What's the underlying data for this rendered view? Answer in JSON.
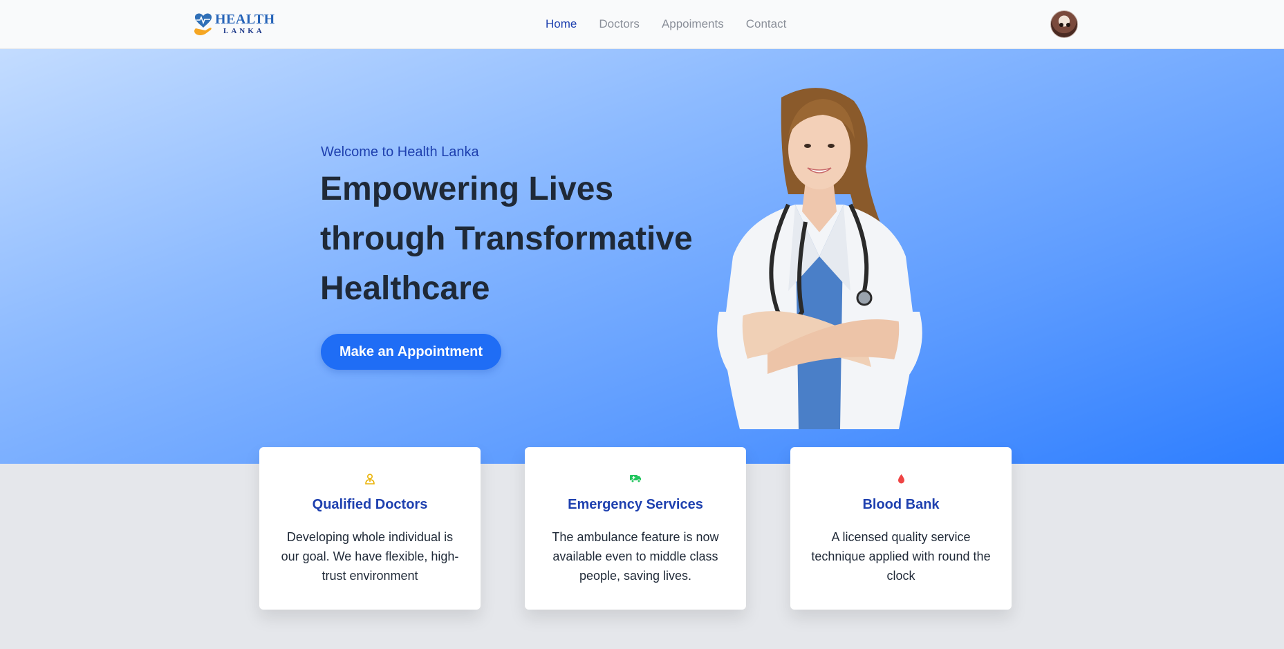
{
  "nav": {
    "logo": {
      "line1": "HEALTH",
      "line2": "LANKA"
    },
    "links": [
      {
        "label": "Home",
        "active": true
      },
      {
        "label": "Doctors",
        "active": false
      },
      {
        "label": "Appoiments",
        "active": false
      },
      {
        "label": "Contact",
        "active": false
      }
    ],
    "avatar_icon": "user-avatar"
  },
  "hero": {
    "subtitle": "Welcome to Health Lanka",
    "title": "Empowering Lives through Transformative Healthcare",
    "cta_label": "Make an Appointment",
    "image": "smiling-doctor-with-stethoscope"
  },
  "features": [
    {
      "icon": "doctor-icon",
      "icon_color": "#eab308",
      "title": "Qualified Doctors",
      "description": "Developing whole individual is our goal. We have flexible, high-trust environment"
    },
    {
      "icon": "ambulance-icon",
      "icon_color": "#22c55e",
      "title": "Emergency Services",
      "description": "The ambulance feature is now available even to middle class people, saving lives."
    },
    {
      "icon": "blood-drop-icon",
      "icon_color": "#ef4444",
      "title": "Blood Bank",
      "description": "A licensed quality service technique applied with round the clock"
    }
  ],
  "colors": {
    "accent": "#1e40af",
    "button": "#1f6df5",
    "hero_gradient_start": "#c3dcff",
    "hero_gradient_end": "#2e7eff"
  }
}
